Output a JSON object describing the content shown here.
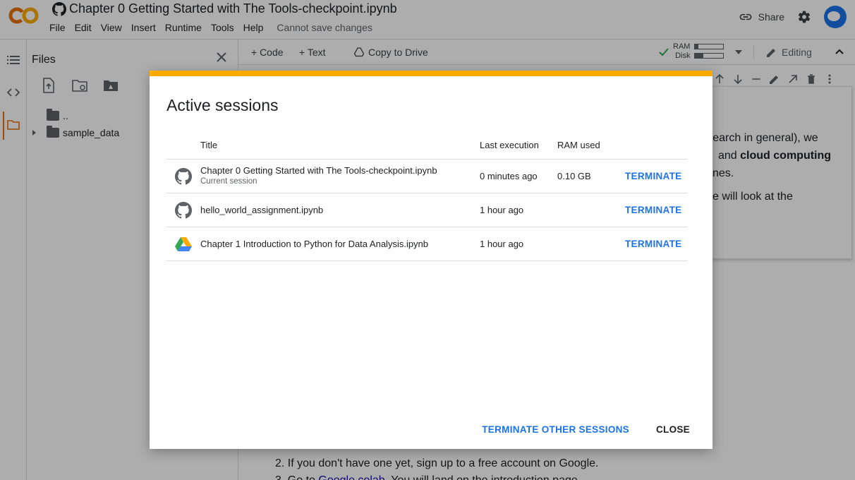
{
  "header": {
    "title": "Chapter 0 Getting Started with The Tools-checkpoint.ipynb",
    "menu": [
      "File",
      "Edit",
      "View",
      "Insert",
      "Runtime",
      "Tools",
      "Help"
    ],
    "save_status": "Cannot save changes",
    "share_label": "Share"
  },
  "files_panel": {
    "title": "Files",
    "items": [
      {
        "label": ".."
      },
      {
        "label": "sample_data"
      }
    ]
  },
  "toolbar": {
    "code_label": "+ Code",
    "text_label": "+ Text",
    "copy_label": "Copy to Drive",
    "ram_label": "RAM",
    "disk_label": "Disk",
    "ram_fraction": 0.12,
    "disk_fraction": 0.28,
    "editing_label": "Editing"
  },
  "notebook": {
    "frag1": "research in general), we",
    "frag2a": "and",
    "frag2b": "cloud computing",
    "frag3": "nes.",
    "frag4": "e will look at the",
    "step2": "2. If you don't have one yet, sign up to a free account on Google.",
    "step3a": "3. Go to",
    "step3link": "Google colab",
    "step3b": ". You will land on the introduction page."
  },
  "dialog": {
    "title": "Active sessions",
    "columns": {
      "title": "Title",
      "last_execution": "Last execution",
      "ram_used": "RAM used"
    },
    "sessions": [
      {
        "icon": "github-icon",
        "name": "Chapter 0 Getting Started with The Tools-checkpoint.ipynb",
        "subtitle": "Current session",
        "last_execution": "0 minutes ago",
        "ram_used": "0.10 GB",
        "action": "TERMINATE"
      },
      {
        "icon": "github-icon",
        "name": "hello_world_assignment.ipynb",
        "subtitle": "",
        "last_execution": "1 hour ago",
        "ram_used": "",
        "action": "TERMINATE"
      },
      {
        "icon": "google-drive-icon",
        "name": "Chapter 1 Introduction to Python for Data Analysis.ipynb",
        "subtitle": "",
        "last_execution": "1 hour ago",
        "ram_used": "",
        "action": "TERMINATE"
      }
    ],
    "terminate_others_label": "TERMINATE OTHER SESSIONS",
    "close_label": "CLOSE"
  },
  "colors": {
    "accent": "#f9ab00",
    "link": "#1a73e8",
    "brand_orange": "#e8710a"
  }
}
